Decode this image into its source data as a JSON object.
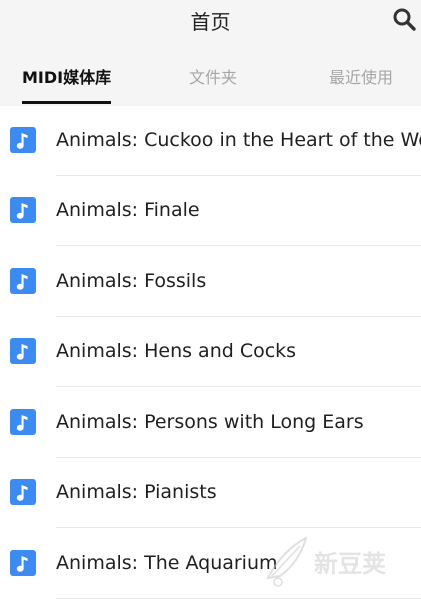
{
  "header": {
    "title": "首页",
    "search_icon": "search-icon"
  },
  "tabs": [
    {
      "label": "MIDI媒体库",
      "active": true
    },
    {
      "label": "文件夹",
      "active": false
    },
    {
      "label": "最近使用",
      "active": false
    }
  ],
  "list": {
    "icon": "music-note-icon",
    "accent_color": "#3d8bf0",
    "items": [
      {
        "title": "Animals: Cuckoo in the Heart of the Wood"
      },
      {
        "title": "Animals: Finale"
      },
      {
        "title": "Animals: Fossils"
      },
      {
        "title": "Animals: Hens and Cocks"
      },
      {
        "title": "Animals: Persons with Long Ears"
      },
      {
        "title": "Animals: Pianists"
      },
      {
        "title": "Animals: The Aquarium"
      }
    ]
  },
  "watermark": {
    "icon": "feather-logo-icon",
    "text": "新豆荚"
  }
}
